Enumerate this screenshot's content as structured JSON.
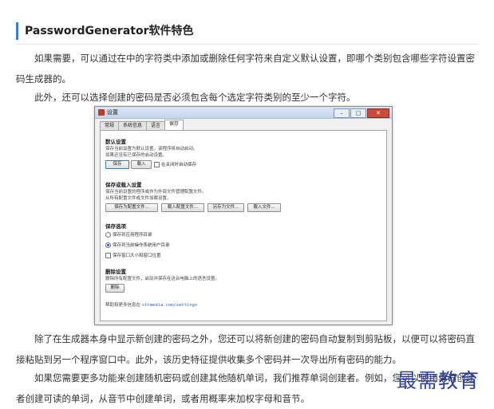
{
  "heading": "PasswordGenerator软件特色",
  "paragraphs": [
    "如果需要，可以通过在中的字符类中添加或删除任何字符来自定义默认设置，即哪个类别包含哪些字符设置密码生成器的。",
    "此外，还可以选择创建的密码是否必须包含每个选定字符类别的至少一个字符。",
    "除了在生成器本身中显示新创建的密码之外，您还可以将新创建的密码自动复制到剪贴板，以便可以将密码直接粘贴到另一个程序窗口中。此外，该历史特征提供收集多个密码并一次导出所有密码的能力。",
    "如果您需要更多功能来创建随机密码或创建其他随机单词，我们推荐单词创建者。例如，您可以使用单词创建者创建可读的单词，从音节中创建单词，或者用概率来加权字母和音节。"
  ],
  "watermark": "最需教育",
  "dialog": {
    "title": "设置",
    "tabs": [
      "常规",
      "系统信息",
      "语言",
      "保存"
    ],
    "active_tab": 3,
    "default_section": {
      "title": "默认设置",
      "desc1": "保存当前设置为默认设置，该程序将自动启动。",
      "desc2": "如果还没有已保存的启动设置。",
      "save_btn": "保存",
      "load_btn": "载入",
      "autosave_label": "在关闭时自动保存"
    },
    "saveload_section": {
      "title": "保存或载入设置",
      "desc1": "保存当前设置的程序或作为外部文件管理配置文件。",
      "desc2": "从所有配置文件或文件加载设置。",
      "buttons": [
        "保存为配置文件...",
        "载入配置文件...",
        "另存为文件...",
        "载入文件..."
      ]
    },
    "options_section": {
      "title": "保存选项",
      "radio1": "保存到应用程序目录",
      "radio2": "保存到当前操作系统用户目录",
      "check": "保存窗口大小和窗口位置"
    },
    "delete_section": {
      "title": "删除设置",
      "desc": "删除所有配置文件，启动并保存在这台电脑上的语言设置。",
      "delete_btn": "删除"
    },
    "help_text": "帮助和更多信息在",
    "help_link": "sttmedia.com/settings"
  }
}
